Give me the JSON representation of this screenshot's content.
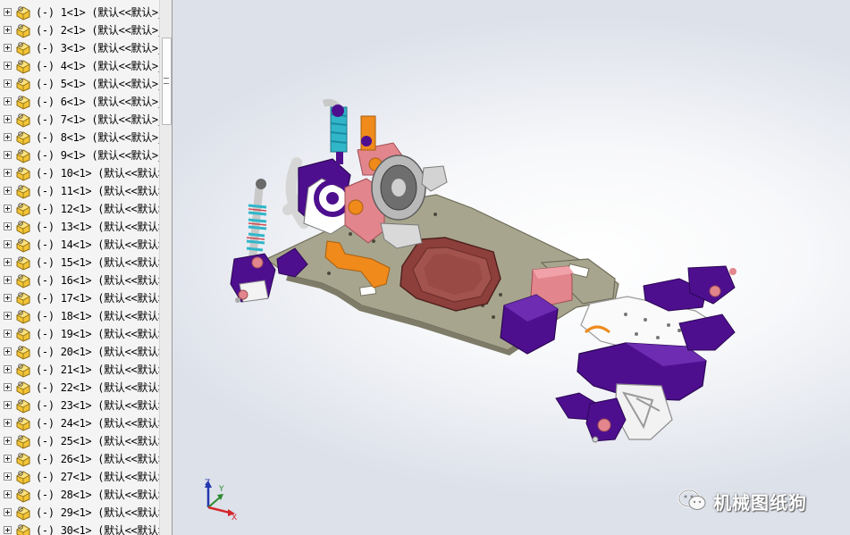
{
  "feature_tree": {
    "items": [
      {
        "label": "(-) 1<1> (默认<<默认>_"
      },
      {
        "label": "(-) 2<1> (默认<<默认>_"
      },
      {
        "label": "(-) 3<1> (默认<<默认>_"
      },
      {
        "label": "(-) 4<1> (默认<<默认>_"
      },
      {
        "label": "(-) 5<1> (默认<<默认>_"
      },
      {
        "label": "(-) 6<1> (默认<<默认>_"
      },
      {
        "label": "(-) 7<1> (默认<<默认>_"
      },
      {
        "label": "(-) 8<1> (默认<<默认>_"
      },
      {
        "label": "(-) 9<1> (默认<<默认>_"
      },
      {
        "label": "(-) 10<1> (默认<<默认>"
      },
      {
        "label": "(-) 11<1> (默认<<默认>"
      },
      {
        "label": "(-) 12<1> (默认<<默认>"
      },
      {
        "label": "(-) 13<1> (默认<<默认>"
      },
      {
        "label": "(-) 14<1> (默认<<默认>"
      },
      {
        "label": "(-) 15<1> (默认<<默认>"
      },
      {
        "label": "(-) 16<1> (默认<<默认>"
      },
      {
        "label": "(-) 17<1> (默认<<默认>"
      },
      {
        "label": "(-) 18<1> (默认<<默认>"
      },
      {
        "label": "(-) 19<1> (默认<<默认>"
      },
      {
        "label": "(-) 20<1> (默认<<默认>"
      },
      {
        "label": "(-) 21<1> (默认<<默认>"
      },
      {
        "label": "(-) 22<1> (默认<<默认>"
      },
      {
        "label": "(-) 23<1> (默认<<默认>"
      },
      {
        "label": "(-) 24<1> (默认<<默认>"
      },
      {
        "label": "(-) 25<1> (默认<<默认>"
      },
      {
        "label": "(-) 26<1> (默认<<默认>"
      },
      {
        "label": "(-) 27<1> (默认<<默认>"
      },
      {
        "label": "(-) 28<1> (默认<<默认>"
      },
      {
        "label": "(-) 29<1> (默认<<默认>"
      },
      {
        "label": "(-) 30<1> (默认<<默认>"
      }
    ]
  },
  "triad": {
    "x_label": "X",
    "y_label": "Y",
    "z_label": "Z"
  },
  "watermark": {
    "text": "机械图纸狗",
    "icon": "wechat-icon"
  },
  "colors": {
    "plate": "#a7a58d",
    "purple": "#4e0f8f",
    "battery": "#8c3f3b",
    "pink": "#e2858c",
    "orange": "#ef8a1b",
    "spring": "#31b6c9",
    "tree_bg": "#f4f4f4",
    "triad_x": "#d4262a",
    "triad_y": "#2a8a2e",
    "triad_z": "#2437b0"
  }
}
